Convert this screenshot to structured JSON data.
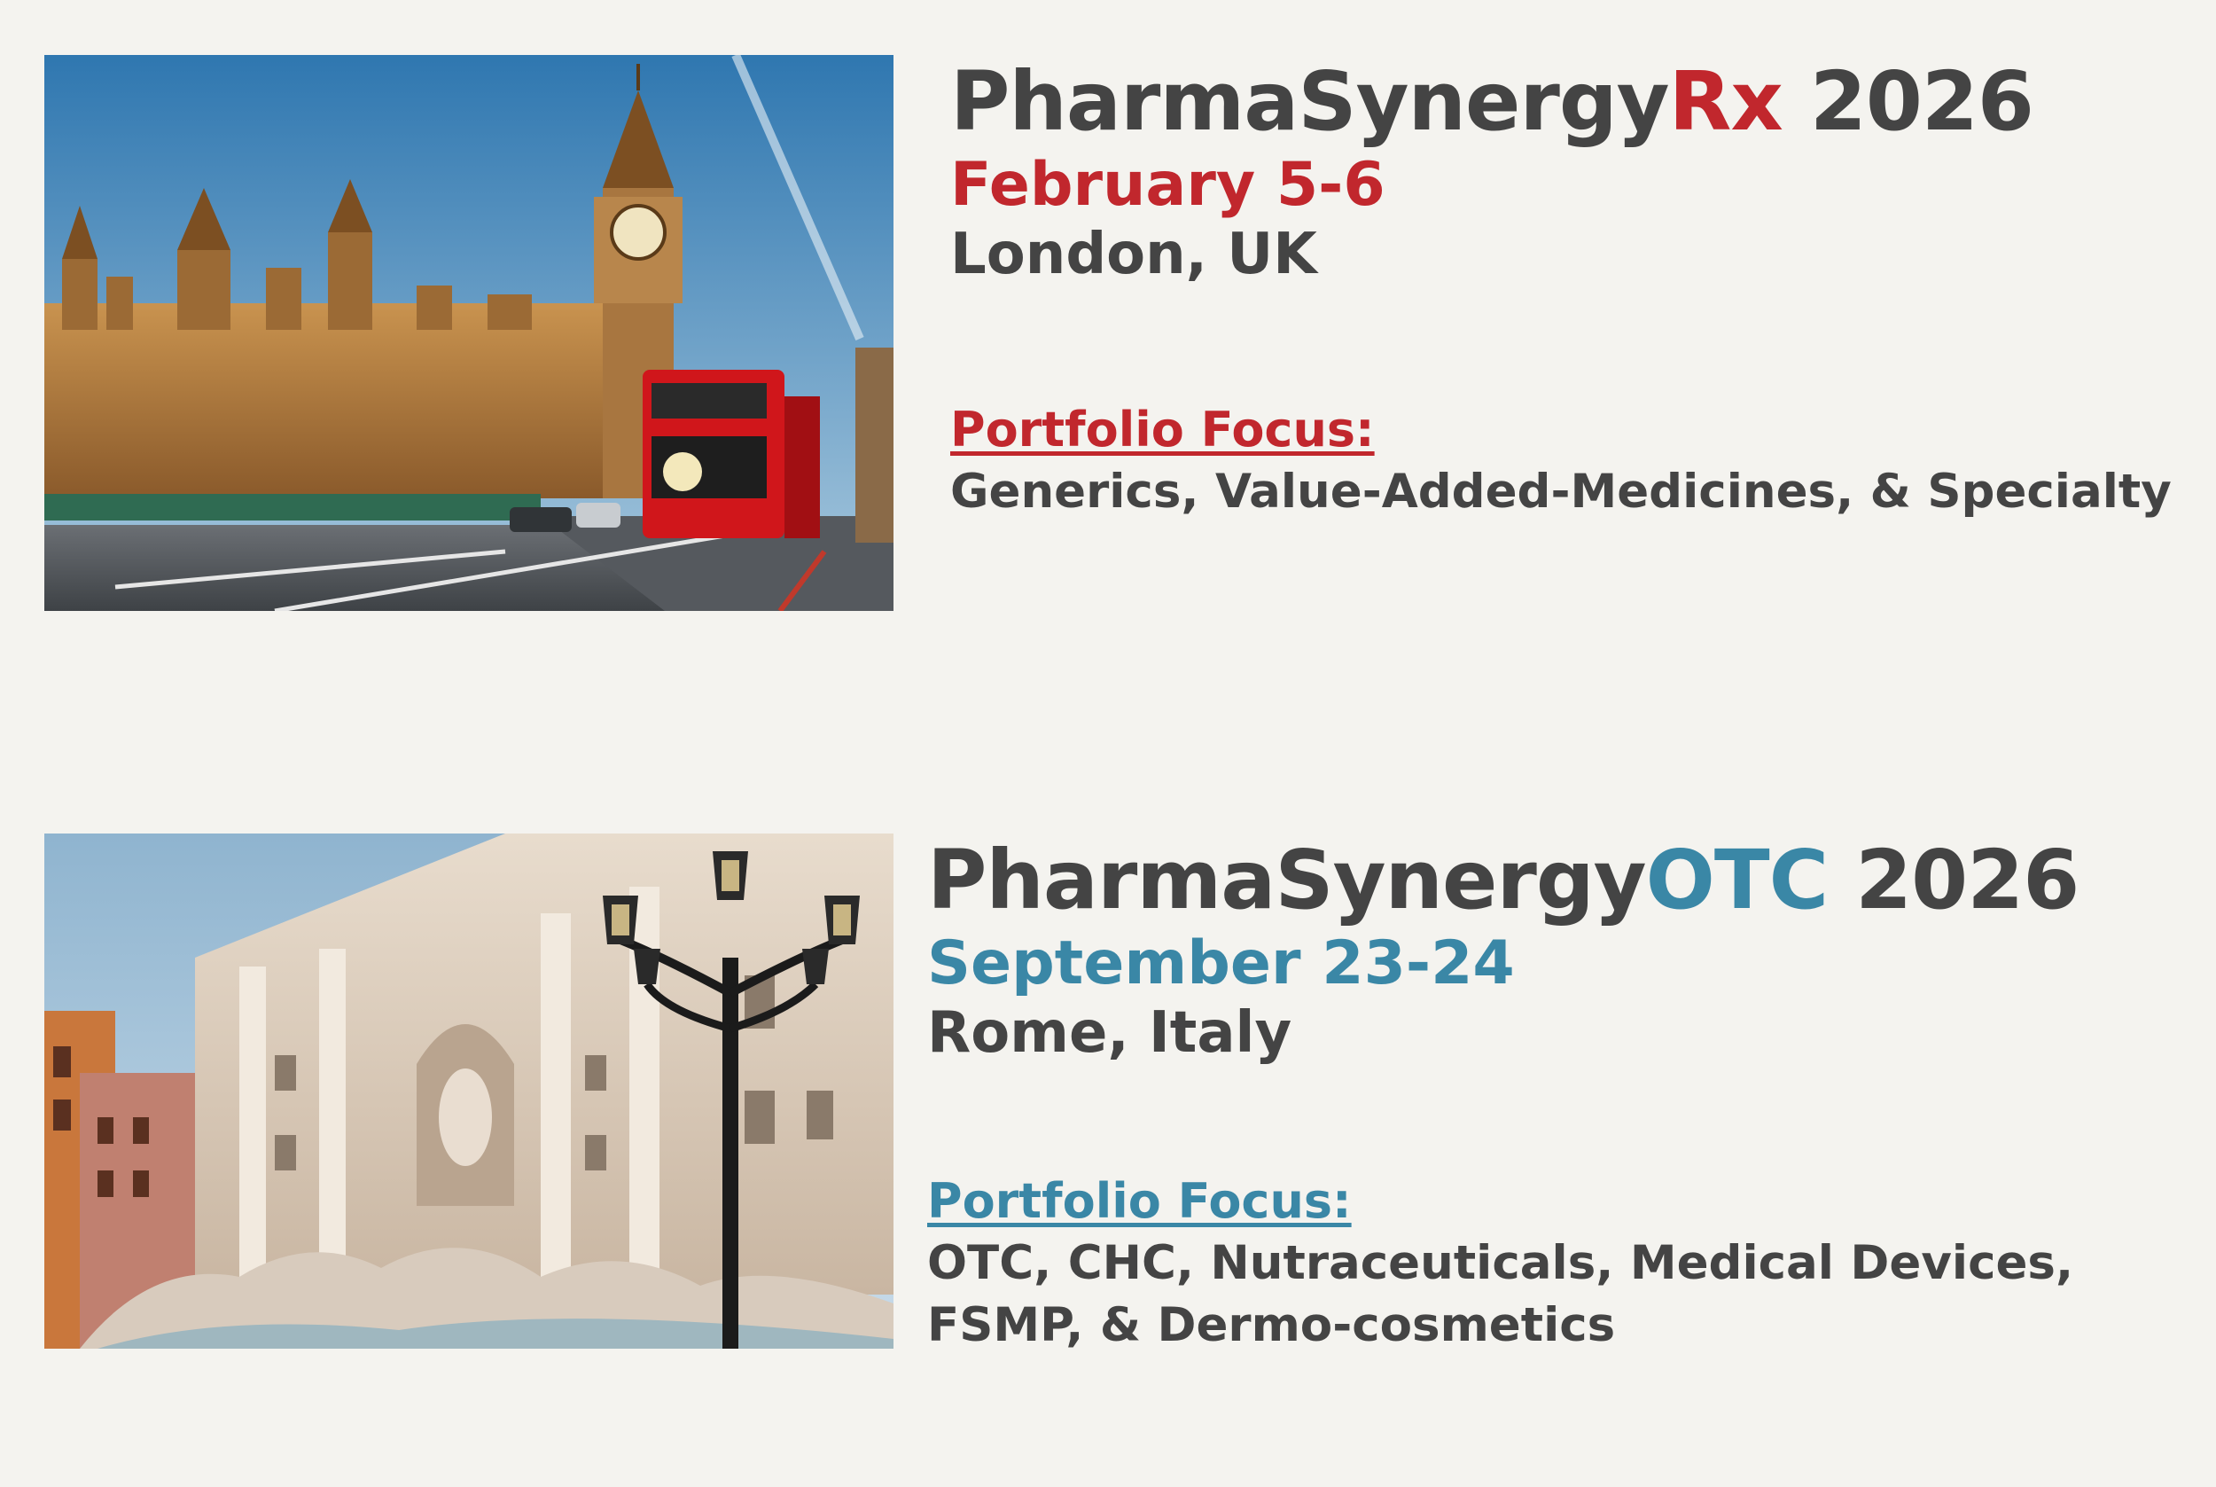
{
  "events": [
    {
      "title_prefix": "PharmaSynergy",
      "title_accent": "Rx",
      "title_year": "2026",
      "date": "February 5-6",
      "location": "London, UK",
      "focus_label": "Portfolio Focus:",
      "focus_lines": [
        "Generics, Value-Added-Medicines, & Specialty"
      ],
      "accent_color": "#c1272d",
      "photo_subject": "london-westminster-big-ben-red-bus-photo"
    },
    {
      "title_prefix": "PharmaSynergy",
      "title_accent": "OTC",
      "title_year": "2026",
      "date": "September 23-24",
      "location": "Rome, Italy",
      "focus_label": "Portfolio Focus:",
      "focus_lines": [
        "OTC, CHC, Nutraceuticals, Medical Devices,",
        "FSMP, & Dermo-cosmetics"
      ],
      "accent_color": "#3a87a6",
      "photo_subject": "rome-trevi-fountain-street-lamp-photo"
    }
  ],
  "colors": {
    "background": "#f4f3ef",
    "text": "#444444"
  }
}
